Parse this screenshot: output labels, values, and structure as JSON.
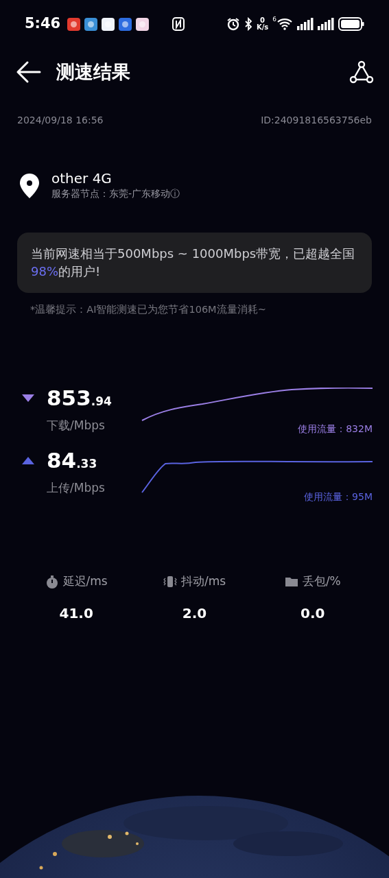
{
  "status_bar": {
    "time": "5:46",
    "net_speed_value": "0",
    "net_speed_unit": "K/s",
    "wifi_badge": "6"
  },
  "header": {
    "title": "测速结果"
  },
  "meta": {
    "date": "2024/09/18 16:56",
    "id": "ID:24091816563756eb"
  },
  "server": {
    "network": "other 4G",
    "node": "服务器节点：东莞-广东移动ⓘ"
  },
  "summary": {
    "segments": [
      {
        "text": "当前网速相当于500Mbps ~ 1000Mbps带宽，已超越全国",
        "highlight": false
      },
      {
        "text": "98%",
        "highlight": true
      },
      {
        "text": "的用户!",
        "highlight": false
      }
    ]
  },
  "tip": "*温馨提示：AI智能测速已为您节省106M流量消耗~",
  "speeds": [
    {
      "kind": "download",
      "integer": "853",
      "decimal": ".94",
      "unit": "下载/Mbps",
      "usage": "使用流量：832M",
      "color": "#9b7fe6"
    },
    {
      "kind": "upload",
      "integer": "84",
      "decimal": ".33",
      "unit": "上传/Mbps",
      "usage": "使用流量：95M",
      "color": "#5a63e0"
    }
  ],
  "stats": [
    {
      "kind": "latency",
      "label": "延迟/ms",
      "value": "41.0"
    },
    {
      "kind": "jitter",
      "label": "抖动/ms",
      "value": "2.0"
    },
    {
      "kind": "loss",
      "label": "丢包/%",
      "value": "0.0"
    }
  ]
}
